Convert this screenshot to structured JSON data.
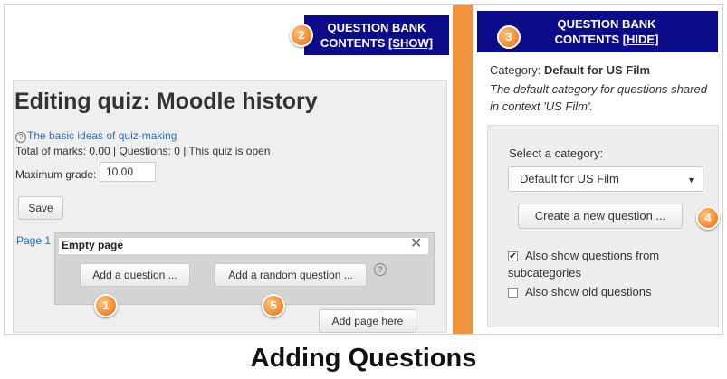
{
  "question_bank_closed": {
    "line1": "QUESTION BANK",
    "line2": "CONTENTS",
    "link": "[SHOW]"
  },
  "question_bank_open": {
    "line1": "QUESTION BANK",
    "line2": "CONTENTS",
    "link": "[HIDE]"
  },
  "quiz": {
    "title": "Editing quiz: Moodle history",
    "help_link": "The basic ideas of quiz-making",
    "totals": "Total of marks: 0.00 | Questions: 0 | This quiz is open",
    "max_grade_label": "Maximum grade:",
    "max_grade_value": "10.00",
    "save_label": "Save",
    "page_label": "Page 1",
    "empty_page": "Empty page",
    "close_symbol": "✕",
    "add_question": "Add a question ...",
    "add_random_question": "Add a random question ...",
    "add_page": "Add page here"
  },
  "category": {
    "label": "Category:",
    "name": "Default for US Film",
    "description": "The default category for questions shared in context 'US Film'.",
    "select_label": "Select a category:",
    "selected_value": "Default for US Film",
    "create_button": "Create a new question ...",
    "show_subcategories_line1": "Also show questions from",
    "show_subcategories_line2": "subcategories",
    "show_subcategories_checked": true,
    "show_old": "Also show old questions",
    "show_old_checked": false
  },
  "callouts": [
    "1",
    "2",
    "3",
    "4",
    "5"
  ],
  "caption": "Adding Questions",
  "colors": {
    "header_bg": "#0c0c8a",
    "divider": "#f0933f",
    "badge": "#f0862a",
    "link": "#2a6ebb"
  }
}
